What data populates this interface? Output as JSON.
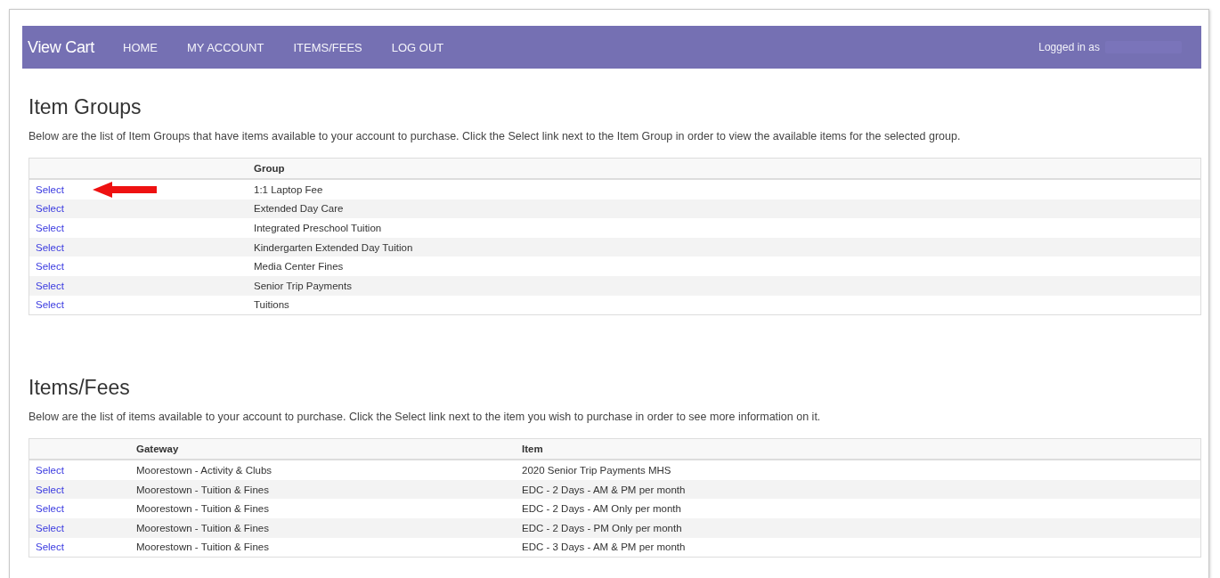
{
  "navbar": {
    "brand": "View Cart",
    "links": [
      "HOME",
      "MY ACCOUNT",
      "ITEMS/FEES",
      "LOG OUT"
    ],
    "user_label": "Logged in as"
  },
  "item_groups": {
    "title": "Item Groups",
    "description": "Below are the list of Item Groups that have items available to your account to purchase. Click the Select link next to the Item Group in order to view the available items for the selected group.",
    "columns": [
      "Group"
    ],
    "rows": [
      {
        "action": "Select",
        "group": "1:1 Laptop Fee",
        "pointer": true
      },
      {
        "action": "Select",
        "group": "Extended Day Care",
        "pointer": false
      },
      {
        "action": "Select",
        "group": "Integrated Preschool Tuition",
        "pointer": false
      },
      {
        "action": "Select",
        "group": "Kindergarten Extended Day Tuition",
        "pointer": false
      },
      {
        "action": "Select",
        "group": "Media Center Fines",
        "pointer": false
      },
      {
        "action": "Select",
        "group": "Senior Trip Payments",
        "pointer": false
      },
      {
        "action": "Select",
        "group": "Tuitions",
        "pointer": false
      }
    ]
  },
  "items_fees": {
    "title": "Items/Fees",
    "description": "Below are the list of items available to your account to purchase. Click the Select link next to the item you wish to purchase in order to see more information on it.",
    "columns": [
      "Gateway",
      "Item"
    ],
    "rows": [
      {
        "action": "Select",
        "gateway": "Moorestown - Activity & Clubs",
        "item": "2020 Senior Trip Payments MHS"
      },
      {
        "action": "Select",
        "gateway": "Moorestown - Tuition & Fines",
        "item": "EDC - 2 Days - AM & PM per month"
      },
      {
        "action": "Select",
        "gateway": "Moorestown - Tuition & Fines",
        "item": "EDC - 2 Days - AM Only per month"
      },
      {
        "action": "Select",
        "gateway": "Moorestown - Tuition & Fines",
        "item": "EDC - 2 Days - PM Only per month"
      },
      {
        "action": "Select",
        "gateway": "Moorestown - Tuition & Fines",
        "item": "EDC - 3 Days - AM & PM per month"
      }
    ]
  }
}
